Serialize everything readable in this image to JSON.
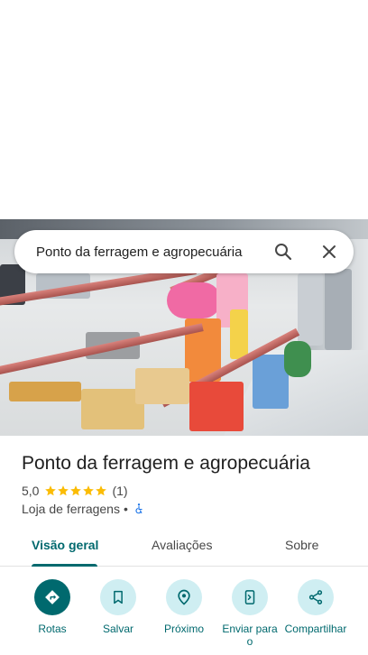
{
  "search": {
    "query": "Ponto da ferragem e agropecuária"
  },
  "place": {
    "name": "Ponto da ferragem e agropecuária",
    "rating": "5,0",
    "stars": 5,
    "review_count": "(1)",
    "category": "Loja de ferragens",
    "separator": "•"
  },
  "tabs": [
    {
      "label": "Visão geral",
      "active": true
    },
    {
      "label": "Avaliações",
      "active": false
    },
    {
      "label": "Sobre",
      "active": false
    }
  ],
  "actions": [
    {
      "label": "Rotas",
      "icon": "directions-icon"
    },
    {
      "label": "Salvar",
      "icon": "bookmark-icon"
    },
    {
      "label": "Próximo",
      "icon": "nearby-icon"
    },
    {
      "label": "Enviar para o",
      "icon": "send-to-phone-icon"
    },
    {
      "label": "Compartilhar",
      "icon": "share-icon"
    }
  ],
  "colors": {
    "accent": "#00696e",
    "star": "#fbbc04",
    "accessible": "#1a73e8",
    "action_bg": "#cfeef2"
  }
}
